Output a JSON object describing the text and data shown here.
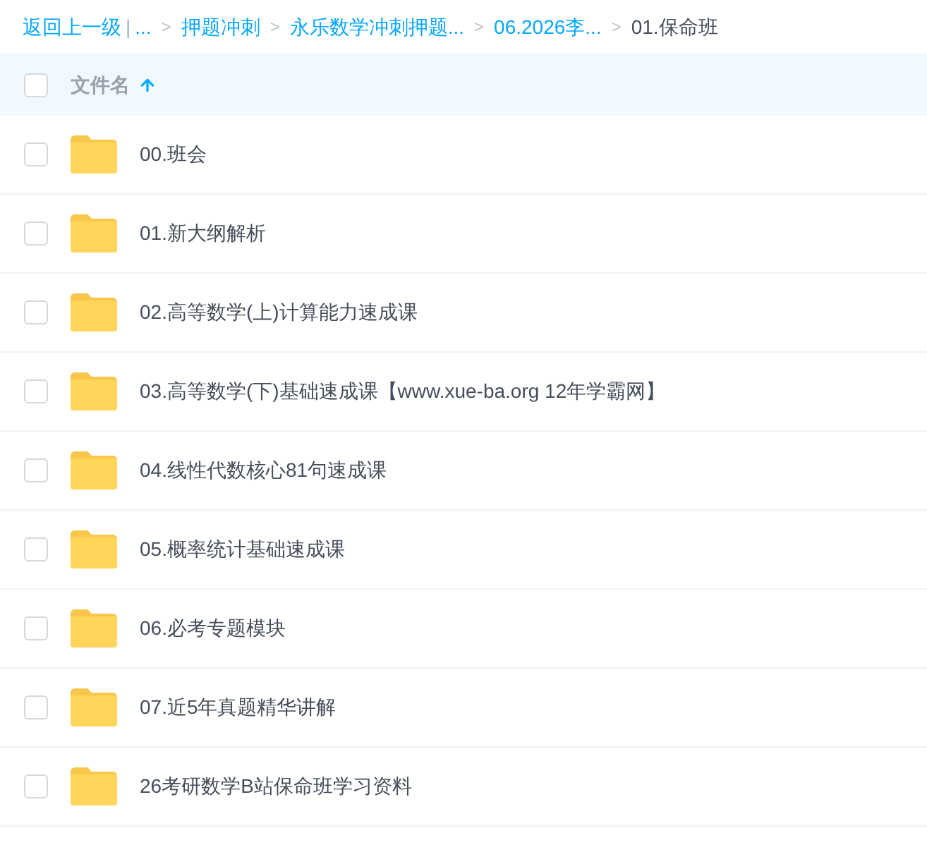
{
  "breadcrumb": {
    "back": "返回上一级",
    "divider": "|",
    "separator": ">",
    "items": [
      {
        "label": "...",
        "current": false
      },
      {
        "label": "押题冲刺",
        "current": false
      },
      {
        "label": "永乐数学冲刺押题...",
        "current": false
      },
      {
        "label": "06.2026李...",
        "current": false
      },
      {
        "label": "01.保命班",
        "current": true
      }
    ]
  },
  "header": {
    "checked": false,
    "column": "文件名",
    "ascending": true
  },
  "files": [
    {
      "name": "00.班会",
      "checked": false
    },
    {
      "name": "01.新大纲解析",
      "checked": false
    },
    {
      "name": "02.高等数学(上)计算能力速成课",
      "checked": false
    },
    {
      "name": "03.高等数学(下)基础速成课【www.xue-ba.org 12年学霸网】",
      "checked": false
    },
    {
      "name": "04.线性代数核心81句速成课",
      "checked": false
    },
    {
      "name": "05.概率统计基础速成课",
      "checked": false
    },
    {
      "name": "06.必考专题模块",
      "checked": false
    },
    {
      "name": "07.近5年真题精华讲解",
      "checked": false
    },
    {
      "name": "26考研数学B站保命班学习资料",
      "checked": false
    }
  ]
}
